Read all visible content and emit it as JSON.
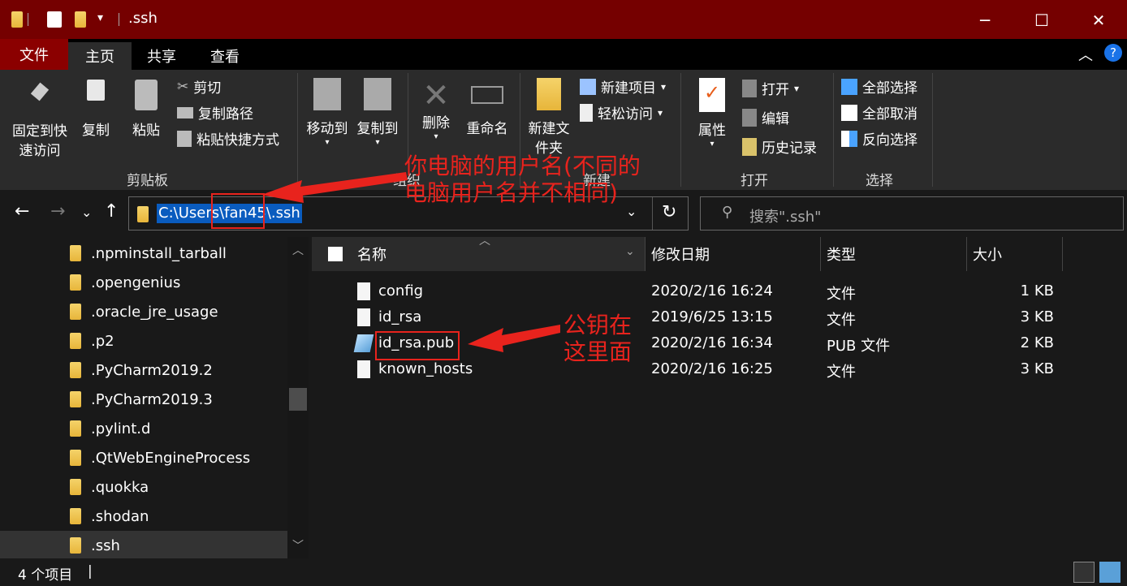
{
  "window": {
    "title": ".ssh",
    "minimize_glyph": "─",
    "maximize_glyph": "☐",
    "close_glyph": "✕"
  },
  "tabs": {
    "file": "文件",
    "home": "主页",
    "share": "共享",
    "view": "查看"
  },
  "ribbon": {
    "clipboard": {
      "pin": "固定到快速访问",
      "copy": "复制",
      "paste": "粘贴",
      "cut": "剪切",
      "copy_path": "复制路径",
      "paste_shortcut": "粘贴快捷方式",
      "label": "剪贴板"
    },
    "organize": {
      "move_to": "移动到",
      "copy_to": "复制到",
      "delete": "删除",
      "rename": "重命名",
      "label": "组织"
    },
    "new": {
      "new_folder": "新建文件夹",
      "new_item": "新建项目",
      "easy_access": "轻松访问",
      "label": "新建"
    },
    "open": {
      "properties": "属性",
      "open": "打开",
      "edit": "编辑",
      "history": "历史记录",
      "label": "打开"
    },
    "select": {
      "select_all": "全部选择",
      "select_none": "全部取消",
      "invert": "反向选择",
      "label": "选择"
    }
  },
  "address": {
    "path": "C:\\Users\\fan45\\.ssh",
    "search_placeholder": "搜索\".ssh\""
  },
  "nav_items": [
    ".npminstall_tarball",
    ".opengenius",
    ".oracle_jre_usage",
    ".p2",
    ".PyCharm2019.2",
    ".PyCharm2019.3",
    ".pylint.d",
    ".QtWebEngineProcess",
    ".quokka",
    ".shodan",
    ".ssh"
  ],
  "columns": {
    "name": "名称",
    "modified": "修改日期",
    "type": "类型",
    "size": "大小"
  },
  "files": [
    {
      "name": "config",
      "modified": "2020/2/16 16:24",
      "type": "文件",
      "size": "1 KB"
    },
    {
      "name": "id_rsa",
      "modified": "2019/6/25 13:15",
      "type": "文件",
      "size": "3 KB"
    },
    {
      "name": "id_rsa.pub",
      "modified": "2020/2/16 16:34",
      "type": "PUB 文件",
      "size": "2 KB"
    },
    {
      "name": "known_hosts",
      "modified": "2020/2/16 16:25",
      "type": "文件",
      "size": "3 KB"
    }
  ],
  "status": {
    "count": "4 个项目"
  },
  "annotations": {
    "username_line1": "你电脑的用户名(不同的",
    "username_line2": "电脑用户名并不相同)",
    "pubkey_line1": "公钥在",
    "pubkey_line2": "这里面"
  },
  "colors": {
    "title_bar": "#750000",
    "file_tab": "#8b0000",
    "selection": "#0a5cbf",
    "annotation": "#e8231d"
  }
}
